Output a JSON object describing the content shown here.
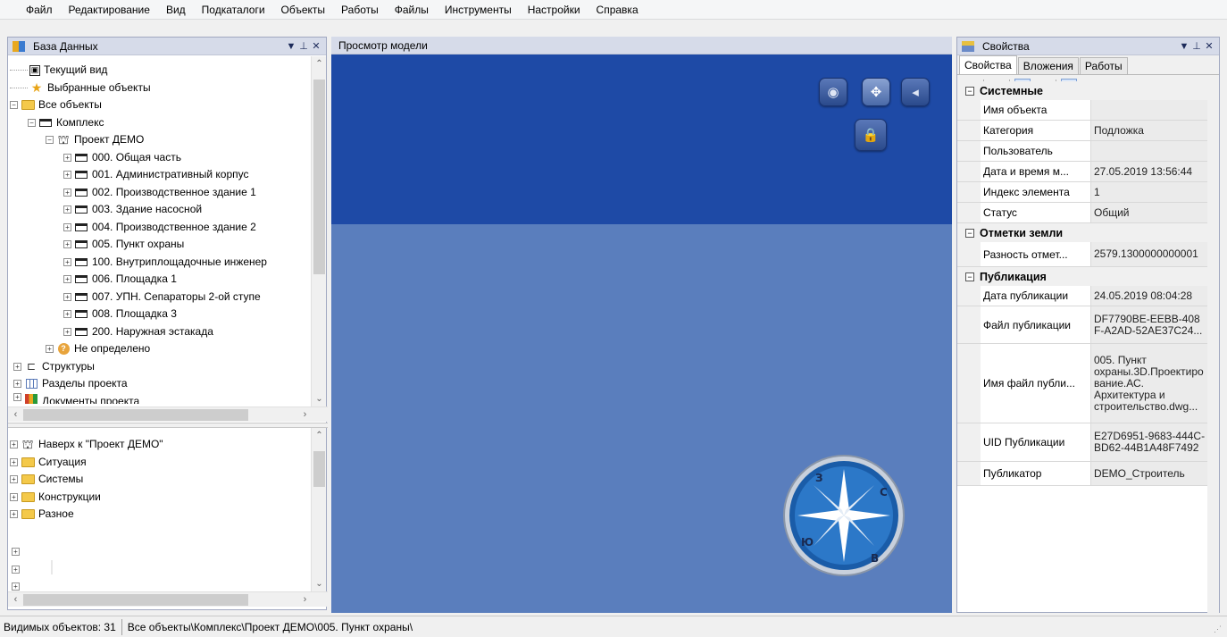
{
  "menu": [
    "Файл",
    "Редактирование",
    "Вид",
    "Подкаталоги",
    "Объекты",
    "Работы",
    "Файлы",
    "Инструменты",
    "Настройки",
    "Справка"
  ],
  "left_panel": {
    "title": "База Данных",
    "tree": [
      {
        "label": "Текущий вид",
        "icon": "view-icon"
      },
      {
        "label": "Выбранные объекты",
        "icon": "star-icon"
      },
      {
        "label": "Все объекты",
        "icon": "folder-icon"
      },
      {
        "label": "Комплекс",
        "icon": "building-icon"
      },
      {
        "label": "Проект ДЕМО",
        "icon": "crane-icon"
      },
      {
        "label": "000. Общая часть",
        "icon": "building-icon"
      },
      {
        "label": "001. Административный корпус",
        "icon": "building-icon"
      },
      {
        "label": "002. Производственное здание 1",
        "icon": "building-icon"
      },
      {
        "label": "003. Здание насосной",
        "icon": "building-icon"
      },
      {
        "label": "004. Производственное здание 2",
        "icon": "building-icon"
      },
      {
        "label": "005. Пункт охраны",
        "icon": "building-icon"
      },
      {
        "label": "100. Внутриплощадочные инженер",
        "icon": "building-icon"
      },
      {
        "label": "006. Площадка 1",
        "icon": "building-icon"
      },
      {
        "label": "007. УПН. Сепараторы 2-ой ступе",
        "icon": "building-icon"
      },
      {
        "label": "008. Площадка 3",
        "icon": "building-icon"
      },
      {
        "label": "200. Наружная эстакада",
        "icon": "building-icon"
      },
      {
        "label": "Не определено",
        "icon": "question-icon"
      },
      {
        "label": "Структуры",
        "icon": "structure-icon"
      },
      {
        "label": "Разделы проекта",
        "icon": "grid-icon"
      },
      {
        "label": "Документы проекта",
        "icon": "documents-icon"
      }
    ],
    "subtree": [
      {
        "label": "Наверх к \"Проект ДЕМО\"",
        "icon": "crane-icon"
      },
      {
        "label": "Ситуация",
        "icon": "folder-icon"
      },
      {
        "label": "Системы",
        "icon": "folder-icon"
      },
      {
        "label": "Конструкции",
        "icon": "folder-icon"
      },
      {
        "label": "Разное",
        "icon": "folder-icon"
      }
    ]
  },
  "viewport": {
    "title": "Просмотр модели",
    "buttons": [
      "eye-icon",
      "navigate-icon",
      "fly-icon"
    ],
    "extra_button": "lock-globe-icon",
    "compass_letters": [
      "С",
      "В",
      "Ю",
      "З"
    ]
  },
  "right_panel": {
    "title": "Свойства",
    "tabs": [
      "Свойства",
      "Вложения",
      "Работы"
    ],
    "categories": [
      {
        "name": "Системные",
        "rows": [
          {
            "name": "Имя объекта",
            "value": ""
          },
          {
            "name": "Категория",
            "value": "Подложка"
          },
          {
            "name": "Пользователь",
            "value": ""
          },
          {
            "name": "Дата и время м...",
            "value": "27.05.2019 13:56:44"
          },
          {
            "name": "Индекс элемента",
            "value": "1"
          },
          {
            "name": "Статус",
            "value": "Общий"
          }
        ]
      },
      {
        "name": "Отметки земли",
        "rows": [
          {
            "name": "Разность отмет...",
            "value": "2579.1300000000001"
          }
        ]
      },
      {
        "name": "Публикация",
        "rows": [
          {
            "name": "Дата публикации",
            "value": "24.05.2019 08:04:28"
          },
          {
            "name": "Файл публикации",
            "value": "DF7790BE-EEBB-408F-A2AD-52AE37C24..."
          },
          {
            "name": "Имя файл публи...",
            "value": "005. Пункт охраны.3D.Проектирование.АС. Архитектура и строительство.dwg..."
          },
          {
            "name": "UID Публикации",
            "value": "E27D6951-9683-444C-BD62-44B1A48F7492"
          },
          {
            "name": "Публикатор",
            "value": "DEMO_Строитель"
          }
        ]
      }
    ]
  },
  "status": {
    "visible": "Видимых объектов: 31",
    "path": "Все объекты\\Комплекс\\Проект ДЕМО\\005. Пункт охраны\\"
  }
}
